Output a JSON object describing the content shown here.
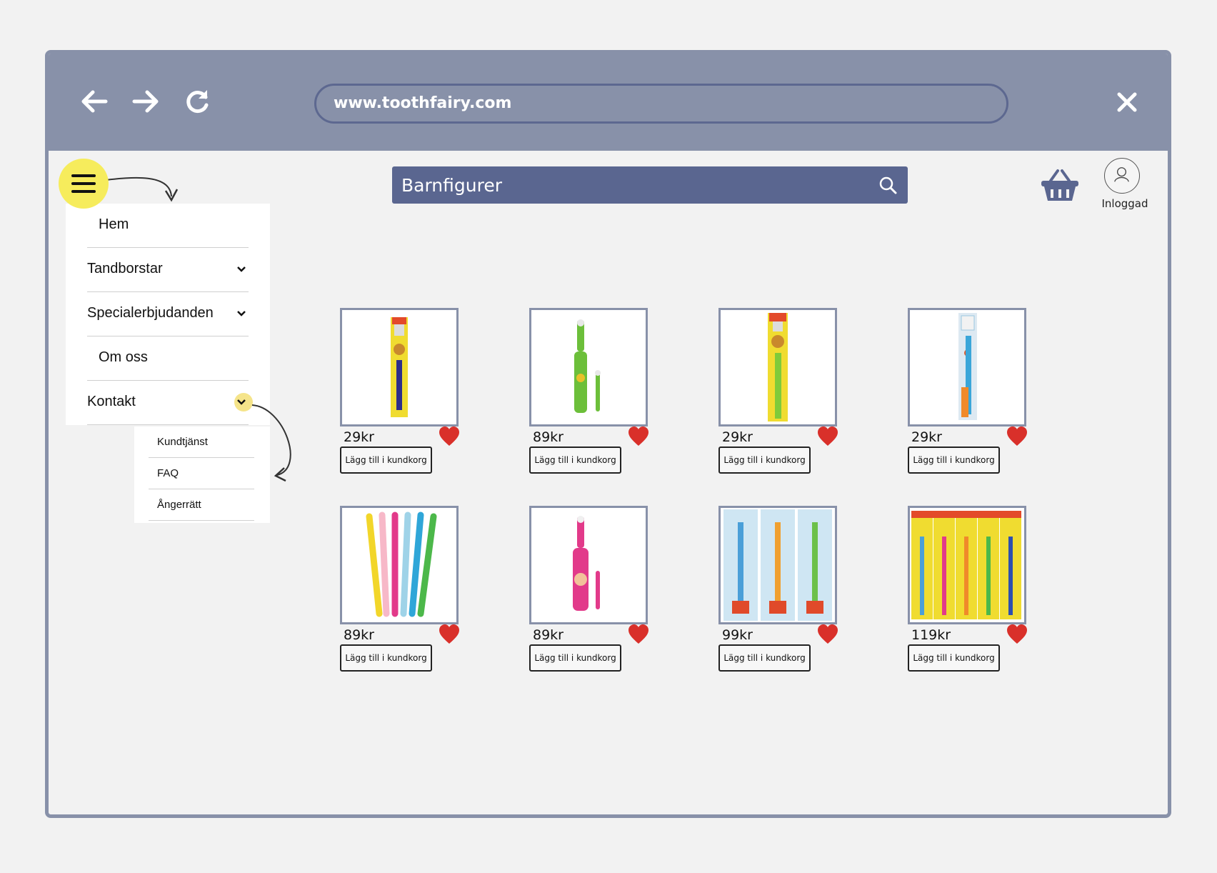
{
  "browser": {
    "url": "www.toothfairy.com"
  },
  "menu": {
    "items": [
      {
        "label": "Hem"
      },
      {
        "label": "Tandborstar"
      },
      {
        "label": "Specialerbjudanden"
      },
      {
        "label": "Om oss"
      },
      {
        "label": "Kontakt"
      }
    ],
    "submenu": [
      {
        "label": "Kundtjänst"
      },
      {
        "label": "FAQ"
      },
      {
        "label": "Ångerrätt"
      }
    ]
  },
  "search": {
    "value": "Barnfigurer"
  },
  "user": {
    "status": "Inloggad"
  },
  "products": [
    {
      "price": "29kr",
      "button": "Lägg till i kundkorg",
      "icon": "toothbrush-package-yellow"
    },
    {
      "price": "89kr",
      "button": "Lägg till i kundkorg",
      "icon": "electric-toothbrush-green"
    },
    {
      "price": "29kr",
      "button": "Lägg till i kundkorg",
      "icon": "toothbrush-package-green"
    },
    {
      "price": "29kr",
      "button": "Lägg till i kundkorg",
      "icon": "toothbrush-package-blue"
    },
    {
      "price": "89kr",
      "button": "Lägg till i kundkorg",
      "icon": "toothbrush-multipack"
    },
    {
      "price": "89kr",
      "button": "Lägg till i kundkorg",
      "icon": "electric-toothbrush-pink"
    },
    {
      "price": "99kr",
      "button": "Lägg till i kundkorg",
      "icon": "toothbrush-kids-3pack"
    },
    {
      "price": "119kr",
      "button": "Lägg till i kundkorg",
      "icon": "toothbrush-5pack"
    }
  ],
  "colors": {
    "chrome": "#8891a9",
    "search": "#5a6690",
    "accent_yellow": "#f6ec5c",
    "heart": "#d9302a"
  }
}
